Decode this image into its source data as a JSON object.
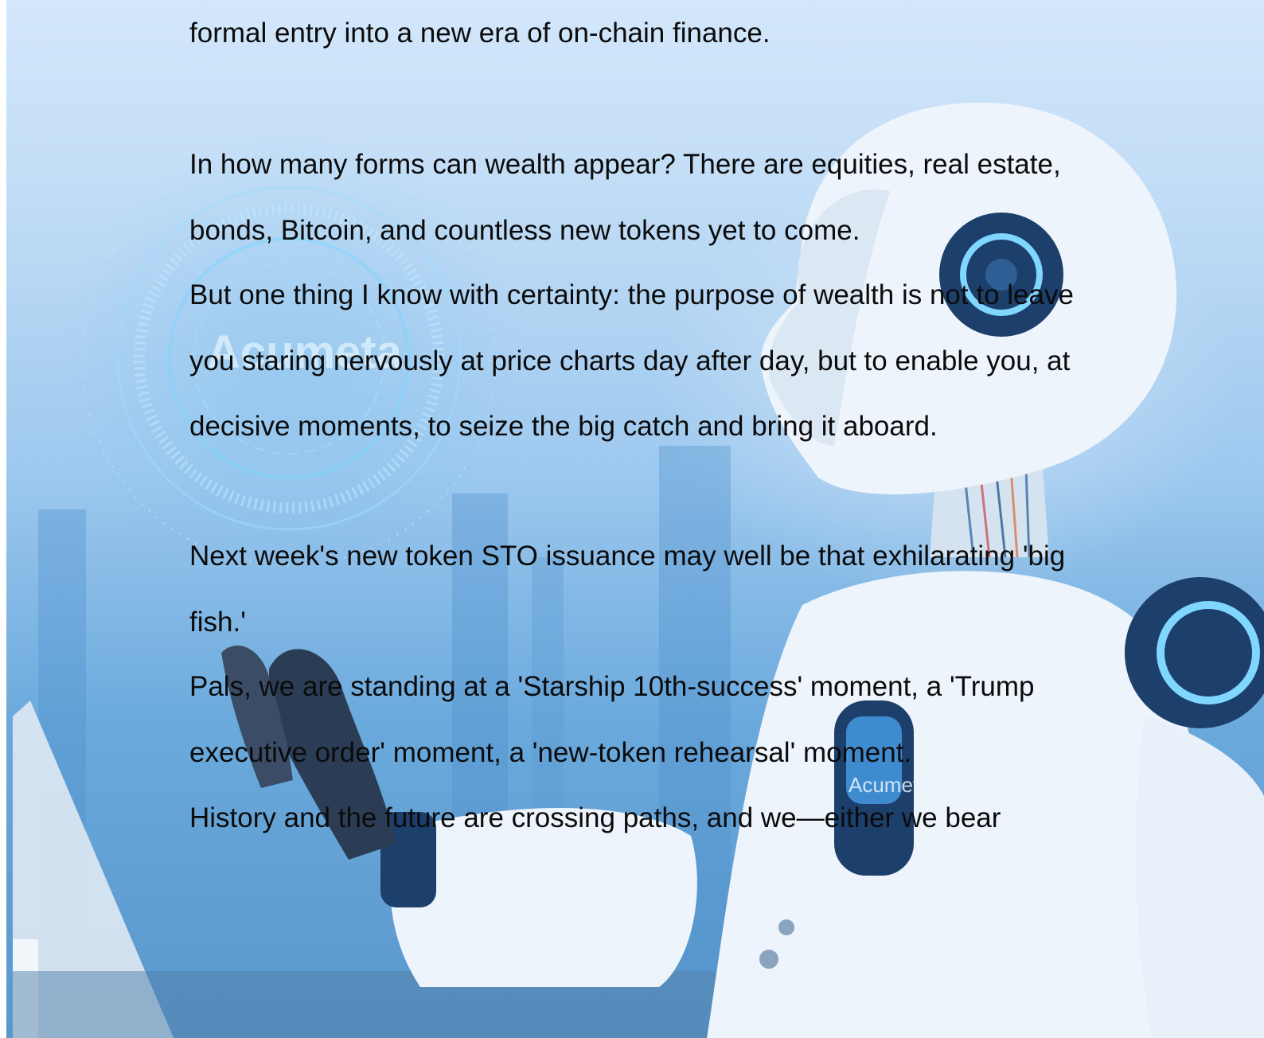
{
  "document": {
    "paragraphs": [
      "formal entry into a new era of on-chain finance.",
      "In how many forms can wealth appear? There are equities, real estate, bonds, Bitcoin, and countless new tokens yet to come.",
      "But one thing I know with certainty: the purpose of wealth is not to leave you staring nervously at price charts day after day, but to enable you, at decisive moments, to seize the big catch and bring it aboard.",
      "Next week's new token STO issuance may well be that exhilarating 'big fish.'",
      "Pals, we are standing at a 'Starship 10th-success' moment, a 'Trump executive order' moment, a 'new-token rehearsal' moment.",
      "History and the future are crossing paths, and we—either we bear"
    ]
  },
  "background": {
    "brand_text": "Acumeta",
    "badge_text": "Acumeta",
    "colors": {
      "top": "#d3e7fb",
      "bottom": "#5a97cc",
      "robot_white": "#eef4fb",
      "robot_dark": "#1c3f6b",
      "glow": "#7fd6ff"
    }
  }
}
